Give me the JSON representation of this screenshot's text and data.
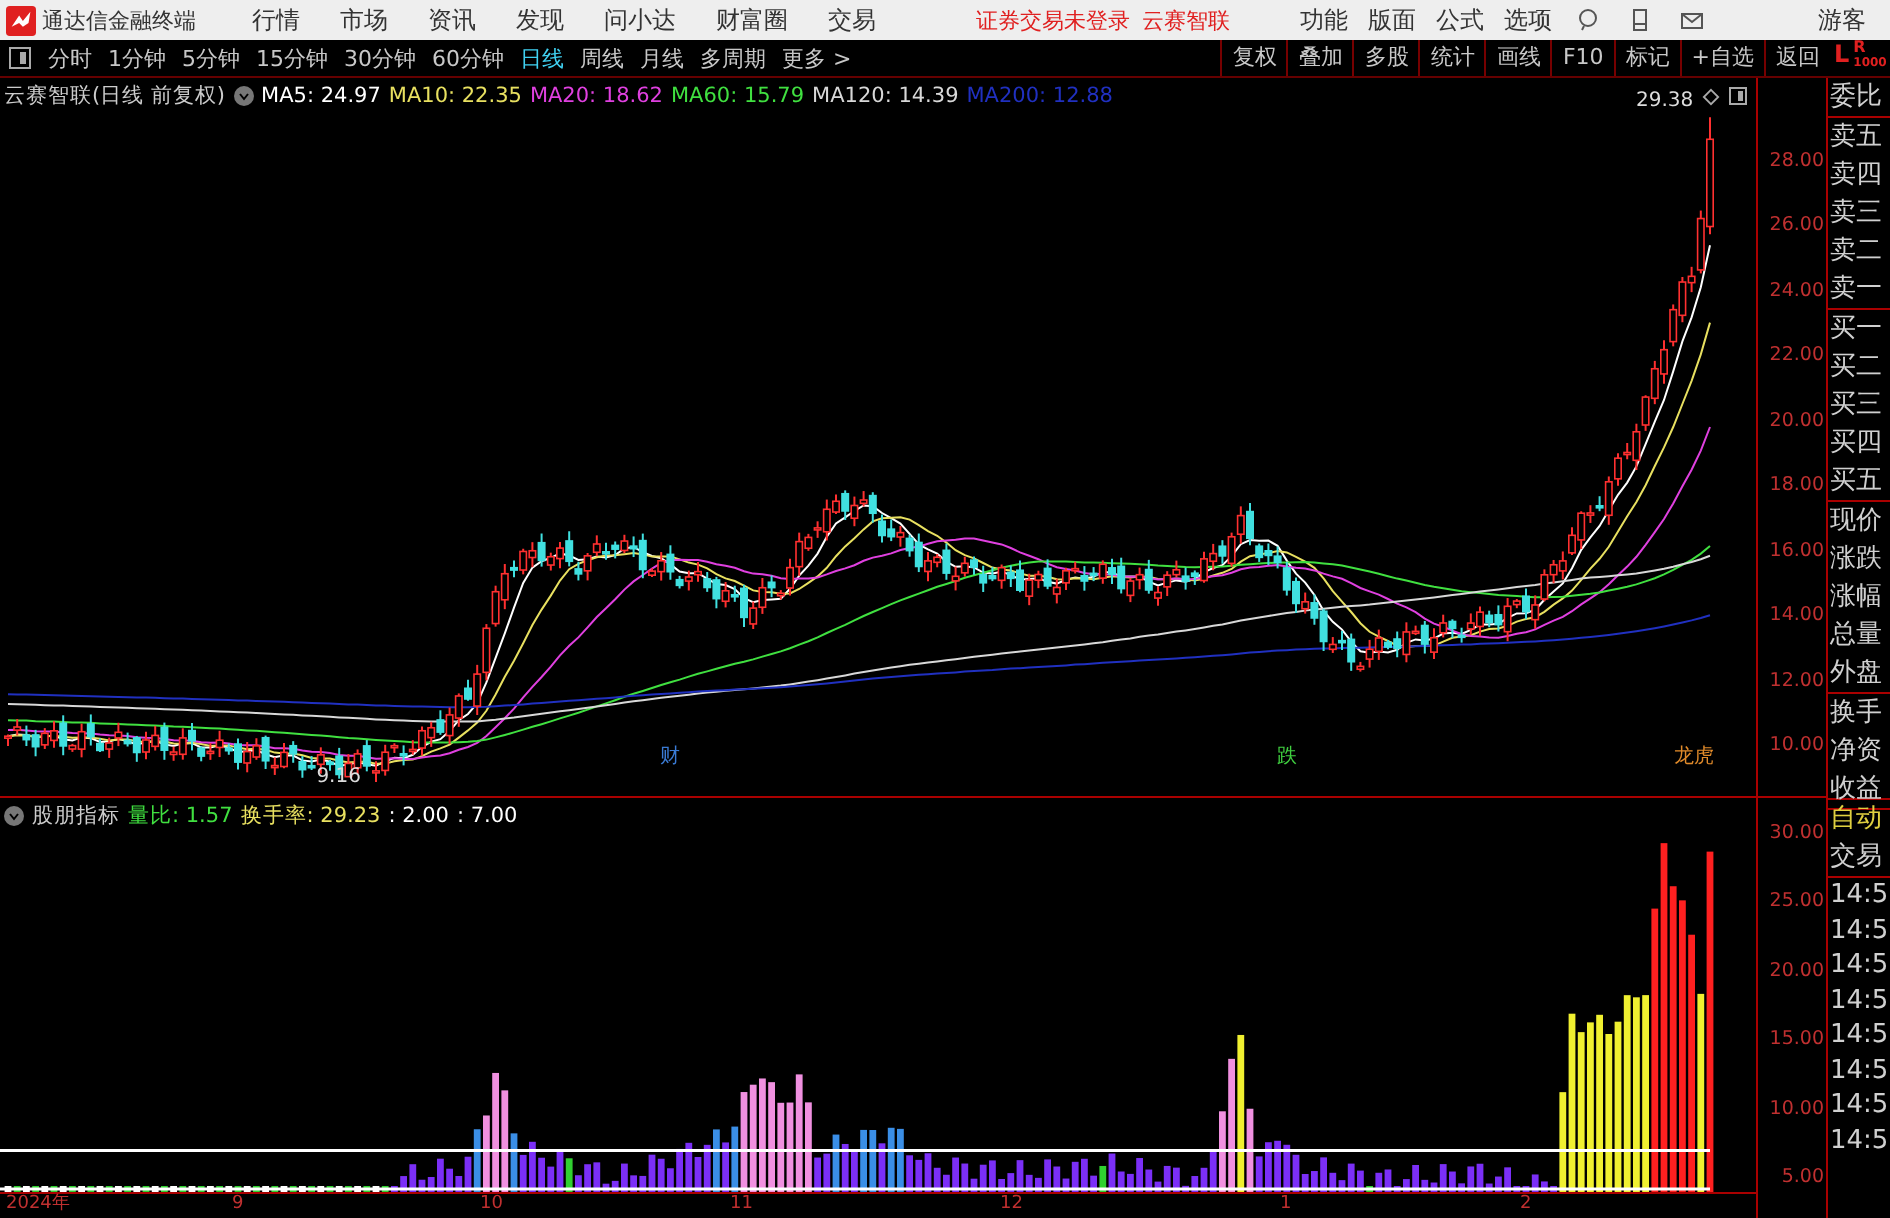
{
  "app": {
    "title": "通达信金融终端",
    "menus": [
      "行情",
      "市场",
      "资讯",
      "发现",
      "问小达",
      "财富圈",
      "交易"
    ],
    "login_status": "证券交易未登录",
    "stock_name": "云赛智联",
    "right_menus": [
      "功能",
      "版面",
      "公式",
      "选项"
    ],
    "user": "游客"
  },
  "toolbar": {
    "periods": [
      {
        "label": "分时",
        "selected": false
      },
      {
        "label": "1分钟",
        "selected": false
      },
      {
        "label": "5分钟",
        "selected": false
      },
      {
        "label": "15分钟",
        "selected": false
      },
      {
        "label": "30分钟",
        "selected": false
      },
      {
        "label": "60分钟",
        "selected": false
      },
      {
        "label": "日线",
        "selected": true
      },
      {
        "label": "周线",
        "selected": false
      },
      {
        "label": "月线",
        "selected": false
      },
      {
        "label": "多周期",
        "selected": false
      }
    ],
    "more": "更多 >",
    "buttons": [
      "复权",
      "叠加",
      "多股",
      "统计",
      "画线",
      "F10",
      "标记",
      "+自选",
      "返回"
    ],
    "badge": {
      "left": "L",
      "right": "R",
      "sub": "1000"
    }
  },
  "price_chart": {
    "title": "云赛智联(日线 前复权)",
    "moving_averages": [
      {
        "label": "MA5: 24.97",
        "color": "#ffffff"
      },
      {
        "label": "MA10: 22.35",
        "color": "#e8e060"
      },
      {
        "label": "MA20: 18.62",
        "color": "#e040e0"
      },
      {
        "label": "MA60: 15.79",
        "color": "#40e040"
      },
      {
        "label": "MA120: 14.39",
        "color": "#d8d8d8"
      },
      {
        "label": "MA200: 12.88",
        "color": "#2030c0"
      }
    ],
    "price_axis": [
      "28.00",
      "26.00",
      "24.00",
      "22.00",
      "20.00",
      "18.00",
      "16.00",
      "14.00",
      "12.00",
      "10.00"
    ],
    "high_label": "29.38",
    "low_label": "9.16",
    "event_marks": [
      {
        "label": "财",
        "color": "#3a7bd5"
      },
      {
        "label": "跌",
        "color": "#40d040"
      },
      {
        "label": "龙虎",
        "color": "#e08a2a"
      }
    ]
  },
  "indicator": {
    "name": "股朋指标",
    "readings": [
      {
        "label": "量比: 1.57",
        "color": "#40e040"
      },
      {
        "label": "换手率: 29.23",
        "color": "#e8e060"
      },
      {
        "label": ": 2.00",
        "color": "#ffffff"
      },
      {
        "label": ": 7.00",
        "color": "#ffffff"
      }
    ],
    "axis": [
      "30.00",
      "25.00",
      "20.00",
      "15.00",
      "10.00",
      "5.00"
    ]
  },
  "time_axis": [
    "2024年",
    "9",
    "10",
    "11",
    "12",
    "1",
    "2"
  ],
  "quote_panel": {
    "groups": [
      [
        "委比"
      ],
      [
        "卖五",
        "卖四",
        "卖三",
        "卖二",
        "卖一"
      ],
      [
        "买一",
        "买二",
        "买三",
        "买四",
        "买五"
      ],
      [
        "现价",
        "涨跌",
        "涨幅",
        "总量",
        "外盘"
      ],
      [
        "换手",
        "净资",
        "收益"
      ]
    ],
    "mode": "自动",
    "section": "交易",
    "ticks": [
      "14:5",
      "14:5",
      "14:5",
      "14:5",
      "14:5",
      "14:5",
      "14:5",
      "14:5"
    ]
  }
}
